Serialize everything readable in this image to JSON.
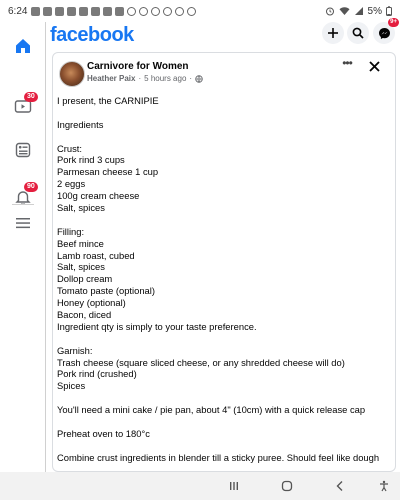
{
  "status_bar": {
    "time": "6:24",
    "battery": "5%"
  },
  "app": {
    "brand": "facebook"
  },
  "rail": {
    "items": [
      {
        "name": "home-icon"
      },
      {
        "name": "video-icon",
        "badge": "30"
      },
      {
        "name": "feeds-icon"
      },
      {
        "name": "notifications-icon",
        "badge": "90"
      },
      {
        "name": "menu-icon"
      }
    ]
  },
  "header": {
    "messenger_badge": "9+"
  },
  "post": {
    "group_name": "Carnivore for Women",
    "author": "Heather Paix",
    "separator": "·",
    "time": "5 hours ago",
    "separator2": "·",
    "more_label": "•••",
    "lines": [
      "I present, the CARNIPIE",
      "",
      "Ingredients",
      "",
      "Crust:",
      "Pork rind 3 cups",
      "Parmesan cheese 1 cup",
      "2 eggs",
      "100g cream cheese",
      "Salt, spices",
      "",
      "Filling:",
      "Beef mince",
      "Lamb roast, cubed",
      "Salt, spices",
      "Dollop cream",
      "Tomato paste (optional)",
      "Honey (optional)",
      "Bacon, diced",
      "Ingredient qty is simply to your taste preference.",
      "",
      "Garnish:",
      "Trash cheese (square sliced cheese, or any shredded cheese will do)",
      "Pork rind (crushed)",
      "Spices",
      "",
      "You'll need a mini cake / pie pan, about 4\" (10cm) with a quick release cap",
      "",
      "Preheat oven to 180°c",
      "",
      "Combine crust ingredients in blender till a sticky puree. Should feel like dough"
    ]
  }
}
